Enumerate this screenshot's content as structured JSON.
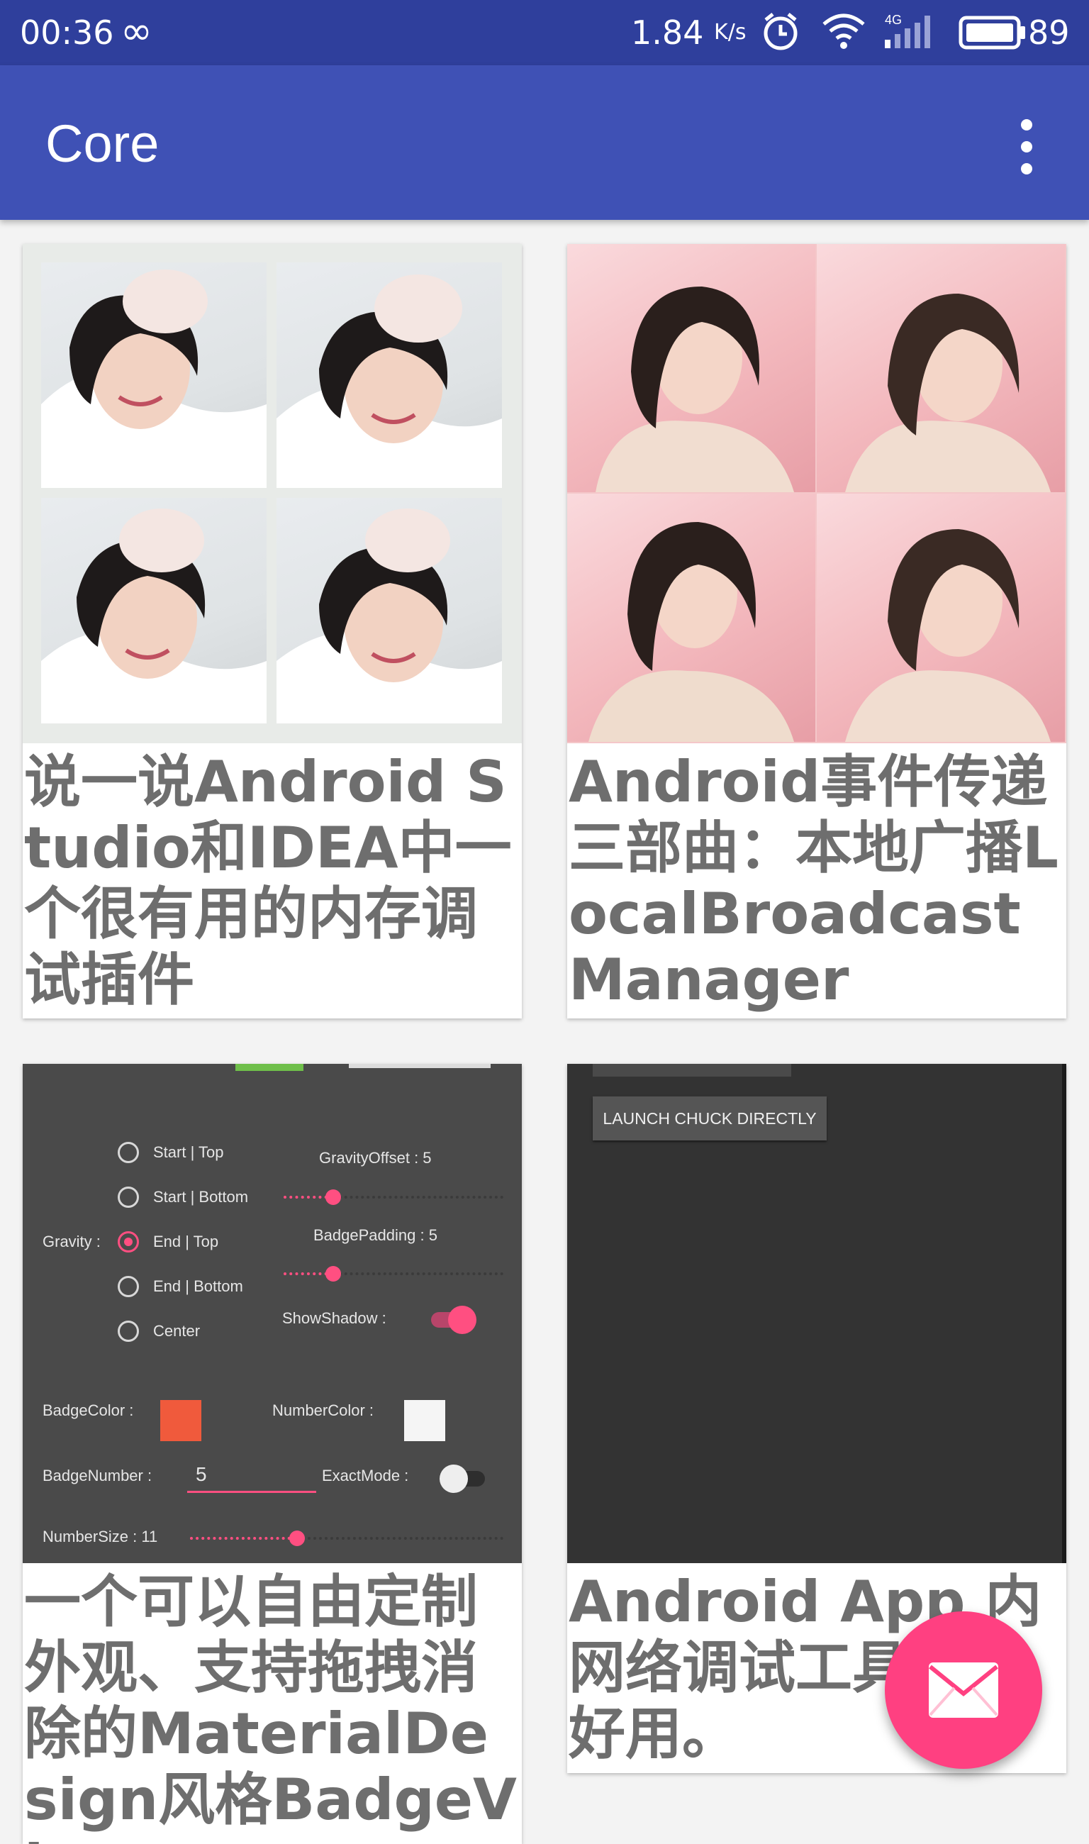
{
  "status_bar": {
    "time": "00:36",
    "speed": "1.84",
    "speed_unit": "K/s",
    "network_type": "4G",
    "battery_percent": "89"
  },
  "app_bar": {
    "title": "Core",
    "overflow_icon": "more-vert-icon"
  },
  "cards": [
    {
      "title": "说一说Android Studio和IDEA中一个很有用的内存调试插件"
    },
    {
      "title": "Android事件传递三部曲：本地广播LocalBroadcastManager"
    },
    {
      "title": "一个可以自由定制外观、支持拖拽消除的MaterialDesign风格BadgeView",
      "screenshot": {
        "gravity_label": "Gravity :",
        "options": [
          "Start | Top",
          "Start | Bottom",
          "End | Top",
          "End | Bottom",
          "Center"
        ],
        "selected_option": "End | Top",
        "gravity_offset": "GravityOffset : 5",
        "badge_padding": "BadgePadding : 5",
        "show_shadow": "ShowShadow :",
        "badge_color": "BadgeColor :",
        "number_color": "NumberColor :",
        "badge_number_label": "BadgeNumber :",
        "badge_number_value": "5",
        "exact_mode": "ExactMode :",
        "number_size": "NumberSize : 11",
        "badge_color_hex": "#f05a3c",
        "number_color_hex": "#ffffff"
      }
    },
    {
      "title": "Android App 内网络调试工具，超好用。",
      "screenshot": {
        "button_label": "LAUNCH CHUCK DIRECTLY"
      }
    }
  ],
  "fab": {
    "icon": "mail-icon"
  },
  "colors": {
    "status_bar": "#2f3f9c",
    "primary": "#3f51b5",
    "accent": "#ff4081"
  }
}
